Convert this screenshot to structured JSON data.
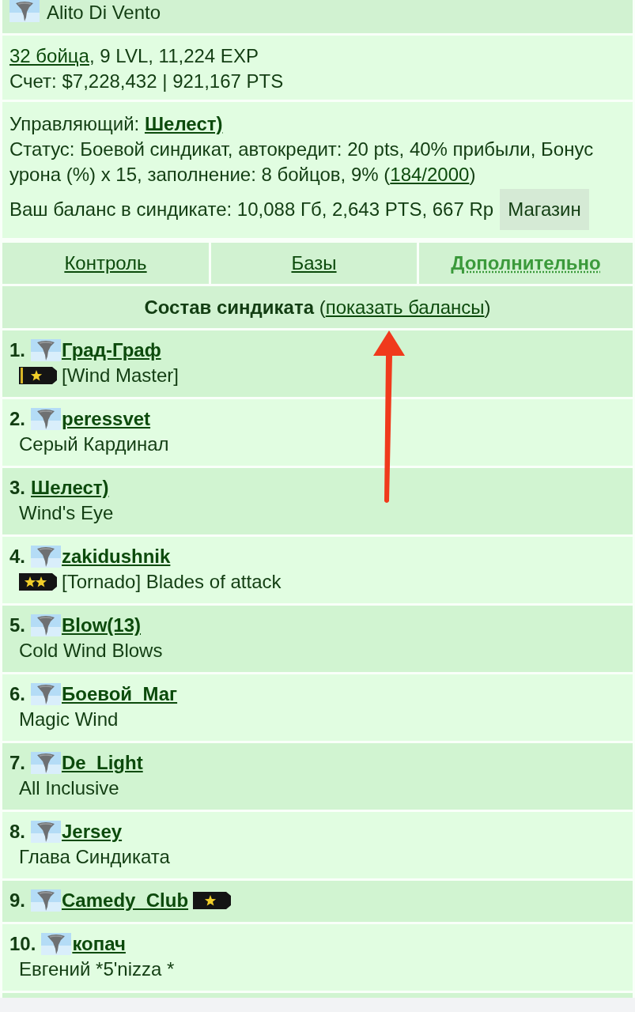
{
  "header": {
    "name": "Alito Di Vento"
  },
  "stats": {
    "fighters_link": "32 бойца",
    "details": ", 9 LVL, 11,224 EXP",
    "score": "Счет: $7,228,432 | 921,167 PTS"
  },
  "info": {
    "manager_label": "Управляющий:",
    "manager_link": "Шелест)",
    "status_text": "Статус: Боевой синдикат, автокредит: 20 pts, 40% прибыли, Бонус урона (%) x 15, заполнение: 8 бойцов, 9% (",
    "status_link": "184/2000",
    "status_end": ")",
    "balance": "Ваш баланс в синдикате: 10,088 Гб, 2,643 PTS, 667 Rp",
    "shop_button": "Магазин"
  },
  "tabs": [
    {
      "label": "Контроль",
      "selected": false
    },
    {
      "label": "Базы",
      "selected": false
    },
    {
      "label": "Дополнительно",
      "selected": true
    }
  ],
  "members_heading": {
    "title": "Состав синдиката",
    "link_open": "(",
    "link": "показать балансы",
    "link_close": ")"
  },
  "members": [
    {
      "number": "1.",
      "avatar": true,
      "name": "Град-Граф",
      "title_badge": {
        "kind": "one_star_striped"
      },
      "title": "[Wind Master]"
    },
    {
      "number": "2.",
      "avatar": true,
      "name": "peressvet",
      "title": "Серый Кардинал"
    },
    {
      "number": "3.",
      "avatar": false,
      "name": "Шелест)",
      "title": "Wind's Eye"
    },
    {
      "number": "4.",
      "avatar": true,
      "name": "zakidushnik",
      "title_badge": {
        "kind": "two_stars"
      },
      "title": "[Tornado] Blades of attack"
    },
    {
      "number": "5.",
      "avatar": true,
      "name": "Blow(13)",
      "title": "Cold Wind Blows"
    },
    {
      "number": "6.",
      "avatar": true,
      "name": "Боевой_Маг",
      "title": "Magic Wind"
    },
    {
      "number": "7.",
      "avatar": true,
      "name": "De_Light",
      "title": "All Inclusive"
    },
    {
      "number": "8.",
      "avatar": true,
      "name": "Jersey",
      "title": "Глава Синдиката"
    },
    {
      "number": "9.",
      "avatar": true,
      "name": "Camedy_Club",
      "name_badge": {
        "kind": "one_star"
      }
    },
    {
      "number": "10.",
      "avatar": true,
      "name": "копач",
      "title": "Евгений *5'nizza *"
    }
  ],
  "annotation": {
    "kind": "arrow"
  }
}
